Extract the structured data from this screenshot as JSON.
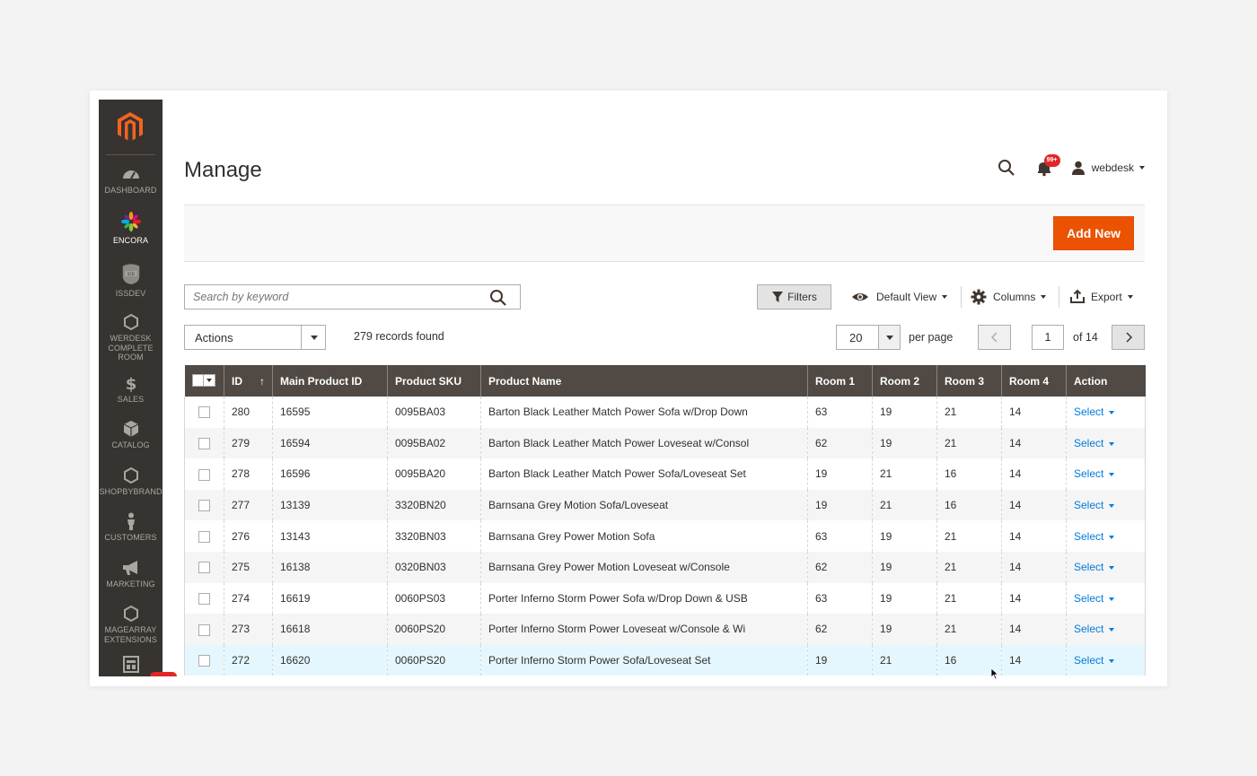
{
  "sidebar": {
    "items": [
      {
        "label": "DASHBOARD",
        "icon": "dashboard-icon"
      },
      {
        "label": "ENCORA",
        "icon": "encora-logo-icon"
      },
      {
        "label": "ISSDEV",
        "icon": "issdev-badge-icon"
      },
      {
        "label": "WERDESK COMPLETE ROOM",
        "icon": "hexagon-icon"
      },
      {
        "label": "SALES",
        "icon": "dollar-icon"
      },
      {
        "label": "CATALOG",
        "icon": "cube-icon"
      },
      {
        "label": "SHOPBYBRAND",
        "icon": "hexagon-icon"
      },
      {
        "label": "CUSTOMERS",
        "icon": "person-icon"
      },
      {
        "label": "MARKETING",
        "icon": "megaphone-icon"
      },
      {
        "label": "MAGEARRAY EXTENSIONS",
        "icon": "hexagon-icon"
      },
      {
        "label": "",
        "icon": "content-icon"
      }
    ]
  },
  "header": {
    "title": "Manage",
    "notifications_badge": "99+",
    "username": "webdesk"
  },
  "action_bar": {
    "add_new": "Add New"
  },
  "toolbar": {
    "search_placeholder": "Search by keyword",
    "filters": "Filters",
    "default_view": "Default View",
    "columns": "Columns",
    "export": "Export"
  },
  "controls": {
    "actions": "Actions",
    "records_found": "279 records found",
    "per_page_value": "20",
    "per_page_label": "per page",
    "current_page": "1",
    "of_pages": "of 14"
  },
  "grid": {
    "columns": [
      "ID",
      "Main Product ID",
      "Product SKU",
      "Product Name",
      "Room 1",
      "Room 2",
      "Room 3",
      "Room 4",
      "Action"
    ],
    "sort_indicator": "↑",
    "action_label": "Select",
    "rows": [
      {
        "id": "280",
        "main_id": "16595",
        "sku": "0095BA03",
        "name": "Barton Black Leather Match Power Sofa w/Drop Down",
        "r1": "63",
        "r2": "19",
        "r3": "21",
        "r4": "14"
      },
      {
        "id": "279",
        "main_id": "16594",
        "sku": "0095BA02",
        "name": "Barton Black Leather Match Power Loveseat w/Consol",
        "r1": "62",
        "r2": "19",
        "r3": "21",
        "r4": "14"
      },
      {
        "id": "278",
        "main_id": "16596",
        "sku": "0095BA20",
        "name": "Barton Black Leather Match Power Sofa/Loveseat Set",
        "r1": "19",
        "r2": "21",
        "r3": "16",
        "r4": "14"
      },
      {
        "id": "277",
        "main_id": "13139",
        "sku": "3320BN20",
        "name": "Barnsana Grey Motion Sofa/Loveseat",
        "r1": "19",
        "r2": "21",
        "r3": "16",
        "r4": "14"
      },
      {
        "id": "276",
        "main_id": "13143",
        "sku": "3320BN03",
        "name": "Barnsana Grey Power Motion Sofa",
        "r1": "63",
        "r2": "19",
        "r3": "21",
        "r4": "14"
      },
      {
        "id": "275",
        "main_id": "16138",
        "sku": "0320BN03",
        "name": "Barnsana Grey Power Motion Loveseat w/Console",
        "r1": "62",
        "r2": "19",
        "r3": "21",
        "r4": "14"
      },
      {
        "id": "274",
        "main_id": "16619",
        "sku": "0060PS03",
        "name": "Porter Inferno Storm Power Sofa w/Drop Down & USB",
        "r1": "63",
        "r2": "19",
        "r3": "21",
        "r4": "14"
      },
      {
        "id": "273",
        "main_id": "16618",
        "sku": "0060PS20",
        "name": "Porter Inferno Storm Power Loveseat w/Console & Wi",
        "r1": "62",
        "r2": "19",
        "r3": "21",
        "r4": "14"
      },
      {
        "id": "272",
        "main_id": "16620",
        "sku": "0060PS20",
        "name": "Porter Inferno Storm Power Sofa/Loveseat Set",
        "r1": "19",
        "r2": "21",
        "r3": "16",
        "r4": "14"
      }
    ]
  },
  "colors": {
    "sidebar_bg": "#373330",
    "brand_orange": "#eb5202",
    "grid_header": "#514943",
    "link_blue": "#007bdb",
    "badge_red": "#e22626",
    "highlight_row": "#e5f7fe"
  }
}
